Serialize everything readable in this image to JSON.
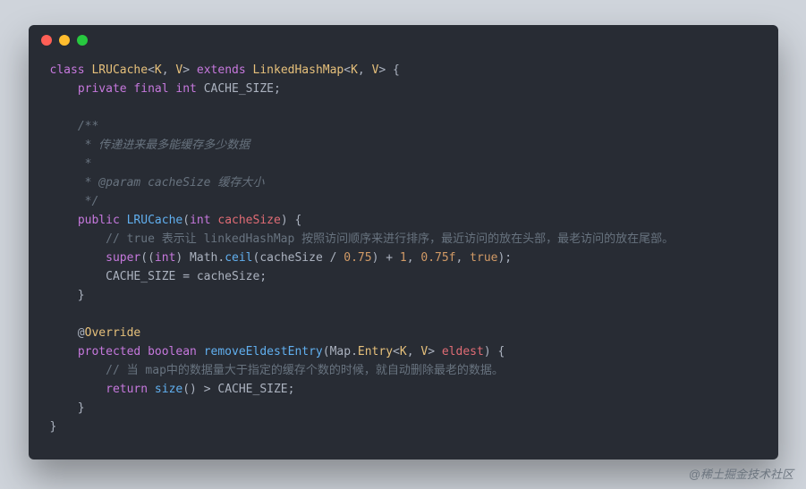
{
  "code": {
    "l1": [
      {
        "t": "class ",
        "c": "kw"
      },
      {
        "t": "LRUCache",
        "c": "type"
      },
      {
        "t": "<",
        "c": "paren"
      },
      {
        "t": "K",
        "c": "type"
      },
      {
        "t": ", ",
        "c": "paren"
      },
      {
        "t": "V",
        "c": "type"
      },
      {
        "t": "> ",
        "c": "paren"
      },
      {
        "t": "extends ",
        "c": "kw"
      },
      {
        "t": "LinkedHashMap",
        "c": "type"
      },
      {
        "t": "<",
        "c": "paren"
      },
      {
        "t": "K",
        "c": "type"
      },
      {
        "t": ", ",
        "c": "paren"
      },
      {
        "t": "V",
        "c": "type"
      },
      {
        "t": "> {",
        "c": "paren"
      }
    ],
    "l2": [
      {
        "t": "    ",
        "c": ""
      },
      {
        "t": "private final int ",
        "c": "kw"
      },
      {
        "t": "CACHE_SIZE;",
        "c": ""
      }
    ],
    "l3": [
      {
        "t": "",
        "c": ""
      }
    ],
    "l4": [
      {
        "t": "    ",
        "c": ""
      },
      {
        "t": "/**",
        "c": "com"
      }
    ],
    "l5": [
      {
        "t": "     * 传递进来最多能缓存多少数据",
        "c": "com"
      }
    ],
    "l6": [
      {
        "t": "     *",
        "c": "com"
      }
    ],
    "l7": [
      {
        "t": "     * @param cacheSize 缓存大小",
        "c": "com"
      }
    ],
    "l8": [
      {
        "t": "     */",
        "c": "com"
      }
    ],
    "l9": [
      {
        "t": "    ",
        "c": ""
      },
      {
        "t": "public ",
        "c": "kw"
      },
      {
        "t": "LRUCache",
        "c": "fn"
      },
      {
        "t": "(",
        "c": "paren"
      },
      {
        "t": "int ",
        "c": "kw"
      },
      {
        "t": "cacheSize",
        "c": "var"
      },
      {
        "t": ") {",
        "c": "paren"
      }
    ],
    "l10": [
      {
        "t": "        ",
        "c": ""
      },
      {
        "t": "// true 表示让 linkedHashMap 按照访问顺序来进行排序，最近访问的放在头部，最老访问的放在尾部。",
        "c": "comline"
      }
    ],
    "l11": [
      {
        "t": "        ",
        "c": ""
      },
      {
        "t": "super",
        "c": "kw"
      },
      {
        "t": "((",
        "c": "paren"
      },
      {
        "t": "int",
        "c": "kw"
      },
      {
        "t": ") Math.",
        "c": ""
      },
      {
        "t": "ceil",
        "c": "fn"
      },
      {
        "t": "(cacheSize / ",
        "c": ""
      },
      {
        "t": "0.75",
        "c": "num"
      },
      {
        "t": ") + ",
        "c": ""
      },
      {
        "t": "1",
        "c": "num"
      },
      {
        "t": ", ",
        "c": ""
      },
      {
        "t": "0.75f",
        "c": "num"
      },
      {
        "t": ", ",
        "c": ""
      },
      {
        "t": "true",
        "c": "num"
      },
      {
        "t": ");",
        "c": "paren"
      }
    ],
    "l12": [
      {
        "t": "        CACHE_SIZE = cacheSize;",
        "c": ""
      }
    ],
    "l13": [
      {
        "t": "    }",
        "c": "paren"
      }
    ],
    "l14": [
      {
        "t": "",
        "c": ""
      }
    ],
    "l15": [
      {
        "t": "    @",
        "c": "ann"
      },
      {
        "t": "Override",
        "c": "type"
      }
    ],
    "l16": [
      {
        "t": "    ",
        "c": ""
      },
      {
        "t": "protected boolean ",
        "c": "kw"
      },
      {
        "t": "removeEldestEntry",
        "c": "fn"
      },
      {
        "t": "(Map.",
        "c": ""
      },
      {
        "t": "Entry",
        "c": "type"
      },
      {
        "t": "<",
        "c": "paren"
      },
      {
        "t": "K",
        "c": "type"
      },
      {
        "t": ", ",
        "c": "paren"
      },
      {
        "t": "V",
        "c": "type"
      },
      {
        "t": "> ",
        "c": "paren"
      },
      {
        "t": "eldest",
        "c": "var"
      },
      {
        "t": ") {",
        "c": "paren"
      }
    ],
    "l17": [
      {
        "t": "        ",
        "c": ""
      },
      {
        "t": "// 当 map中的数据量大于指定的缓存个数的时候，就自动删除最老的数据。",
        "c": "comline"
      }
    ],
    "l18": [
      {
        "t": "        ",
        "c": ""
      },
      {
        "t": "return ",
        "c": "kw"
      },
      {
        "t": "size",
        "c": "fn"
      },
      {
        "t": "() > CACHE_SIZE;",
        "c": ""
      }
    ],
    "l19": [
      {
        "t": "    }",
        "c": "paren"
      }
    ],
    "l20": [
      {
        "t": "}",
        "c": "paren"
      }
    ]
  },
  "watermark": "@稀土掘金技术社区"
}
